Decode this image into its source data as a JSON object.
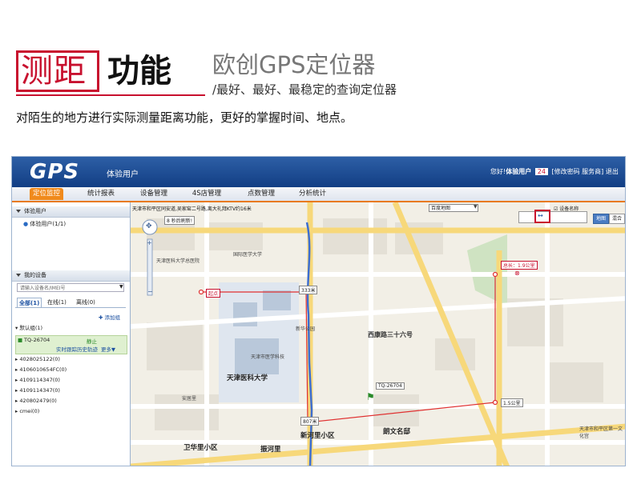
{
  "banner": {
    "title_red": "测距",
    "title_black": "功能",
    "brand": "欧创GPS定位器",
    "slogan": "/最好、最好、最稳定的查询定位器",
    "description": "对陌生的地方进行实际测量距离功能，更好的掌握时间、地点。"
  },
  "app": {
    "logo": "GPS",
    "user_title": "体验用户",
    "user_bar": {
      "hello": "您好!",
      "username": "体验用户",
      "count": "24",
      "change_password": "[修改密码",
      "service": "服务商]",
      "logout": "退出"
    },
    "tabs": [
      "定位监控",
      "统计报表",
      "设备管理",
      "4S店管理",
      "点数管理",
      "分析统计"
    ],
    "active_tab": "定位监控"
  },
  "panel": {
    "users_header": "体验用户",
    "user_item": "体验用户(1/1)",
    "devices_header": "我的设备",
    "search_placeholder": "请输入设备名/IMEI号",
    "status_tabs": [
      "全部(1)",
      "在线(1)",
      "离线(0)"
    ],
    "add_group": "添加组",
    "group_default": "默认组(1)",
    "selected_device": "TQ-26704",
    "selected_status": "静止",
    "device_links": [
      "实时跟踪",
      "历史轨迹",
      "更多▼"
    ],
    "other_groups": [
      "4028025122(0)",
      "4106010654FC(0)",
      "4109114347(0)",
      "4109114347(0)",
      "420802479(0)",
      "cmei(0)"
    ]
  },
  "map": {
    "address": "天津市和平区同安道,吴家窑二号路,离大礼拜KTV约16米",
    "map_select": "百度地图",
    "show_names": "设备名称",
    "map_types": [
      "地图",
      "混合"
    ],
    "refresh_note": "8 秒后刷新!",
    "labels": {
      "school": "天津医科大学",
      "road": "西康路三十六号",
      "area1": "卫华里小区",
      "area2": "振河里",
      "area3": "新河里小区",
      "area4": "朗文名邸",
      "area5": "天津市和平区第一文化宫",
      "intl": "国际医学大学",
      "hospital": "天津医科大学总医院",
      "tech": "天津市医学科技",
      "park": "新华公园",
      "residence": "安居里"
    },
    "measure": {
      "start": "起点",
      "seg1": "333米",
      "seg2": "807米",
      "seg3": "1.5公里",
      "total": "总长：1.9公里"
    },
    "vehicle_label": "TQ-26704"
  }
}
